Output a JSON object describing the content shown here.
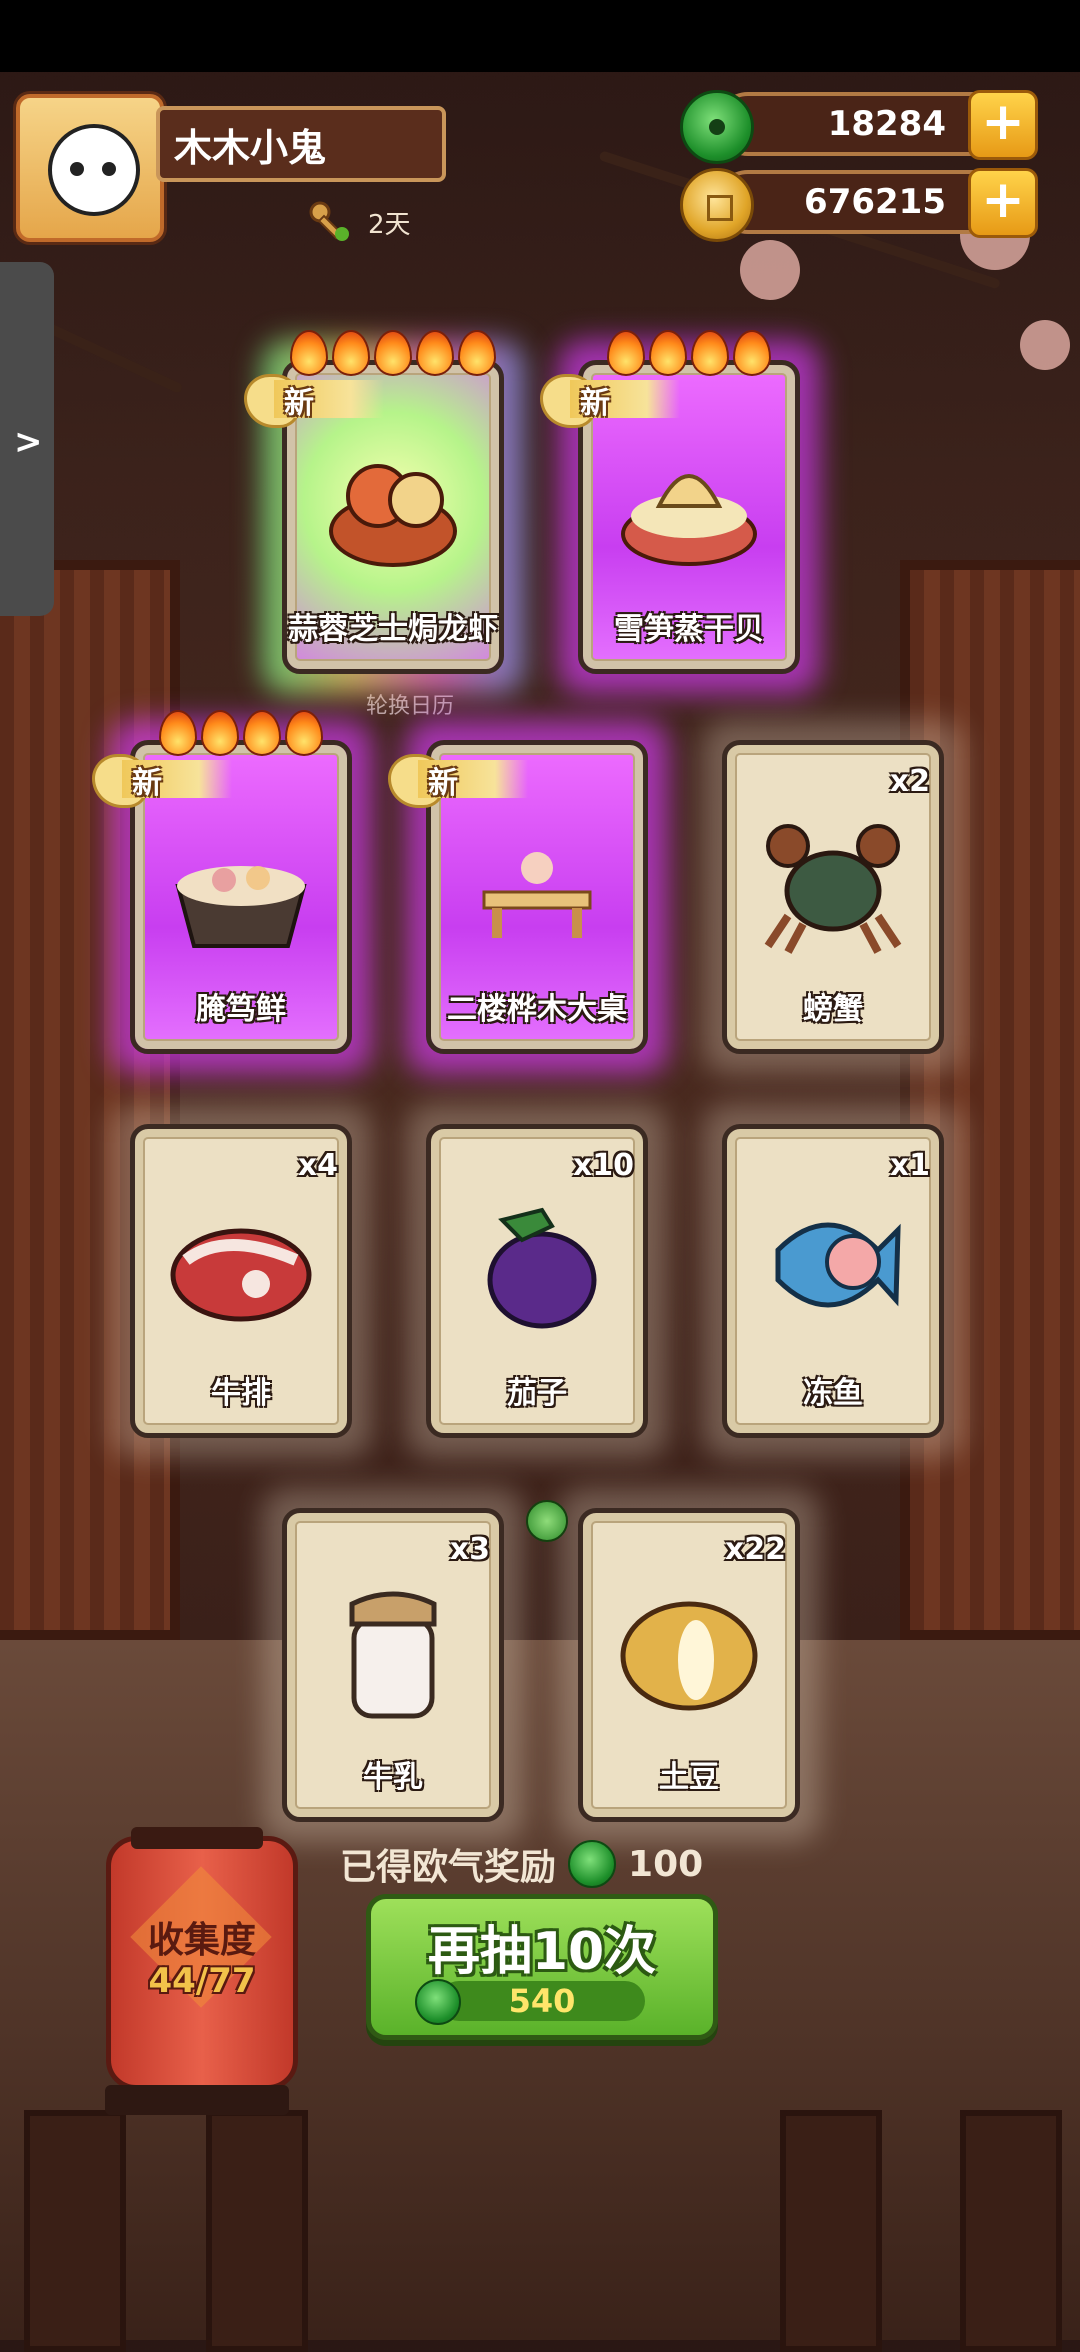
{
  "header": {
    "player_name": "木木小鬼",
    "days": "2天",
    "jade_amount": "18284",
    "coin_amount": "676215"
  },
  "calendar_label": "轮换日历",
  "new_label": "新",
  "cards": [
    {
      "name": "蒜蓉芝士焗龙虾",
      "new": true,
      "rarity": 5,
      "count": "",
      "style": "rainbow",
      "icon": "lobster-dish-icon"
    },
    {
      "name": "雪笋蒸干贝",
      "new": true,
      "rarity": 4,
      "count": "",
      "style": "purple",
      "icon": "scallop-dish-icon"
    },
    {
      "name": "腌笃鲜",
      "new": true,
      "rarity": 4,
      "count": "",
      "style": "purple",
      "icon": "soup-pot-icon"
    },
    {
      "name": "二楼桦木大桌",
      "new": true,
      "rarity": 0,
      "count": "",
      "style": "purple",
      "icon": "table-icon"
    },
    {
      "name": "螃蟹",
      "new": false,
      "rarity": 0,
      "count": "x2",
      "style": "plain",
      "icon": "crab-icon"
    },
    {
      "name": "牛排",
      "new": false,
      "rarity": 0,
      "count": "x4",
      "style": "plain",
      "icon": "steak-icon"
    },
    {
      "name": "茄子",
      "new": false,
      "rarity": 0,
      "count": "x10",
      "style": "plain",
      "icon": "eggplant-icon"
    },
    {
      "name": "冻鱼",
      "new": false,
      "rarity": 0,
      "count": "x1",
      "style": "plain",
      "icon": "frozen-fish-icon"
    },
    {
      "name": "牛乳",
      "new": false,
      "rarity": 0,
      "count": "x3",
      "style": "plain",
      "icon": "milk-jar-icon"
    },
    {
      "name": "土豆",
      "new": false,
      "rarity": 0,
      "count": "x22",
      "style": "plain",
      "icon": "potato-icon"
    }
  ],
  "reward": {
    "label": "已得欧气奖励",
    "amount": "100"
  },
  "redraw": {
    "label": "再抽10次",
    "cost": "540"
  },
  "collection": {
    "label": "收集度",
    "progress": "44/77"
  },
  "colors": {
    "jade": "#1d8f2a",
    "button_green": "#5ab22a",
    "lantern_red": "#c2392a",
    "magic_purple": "#c83ef0"
  }
}
